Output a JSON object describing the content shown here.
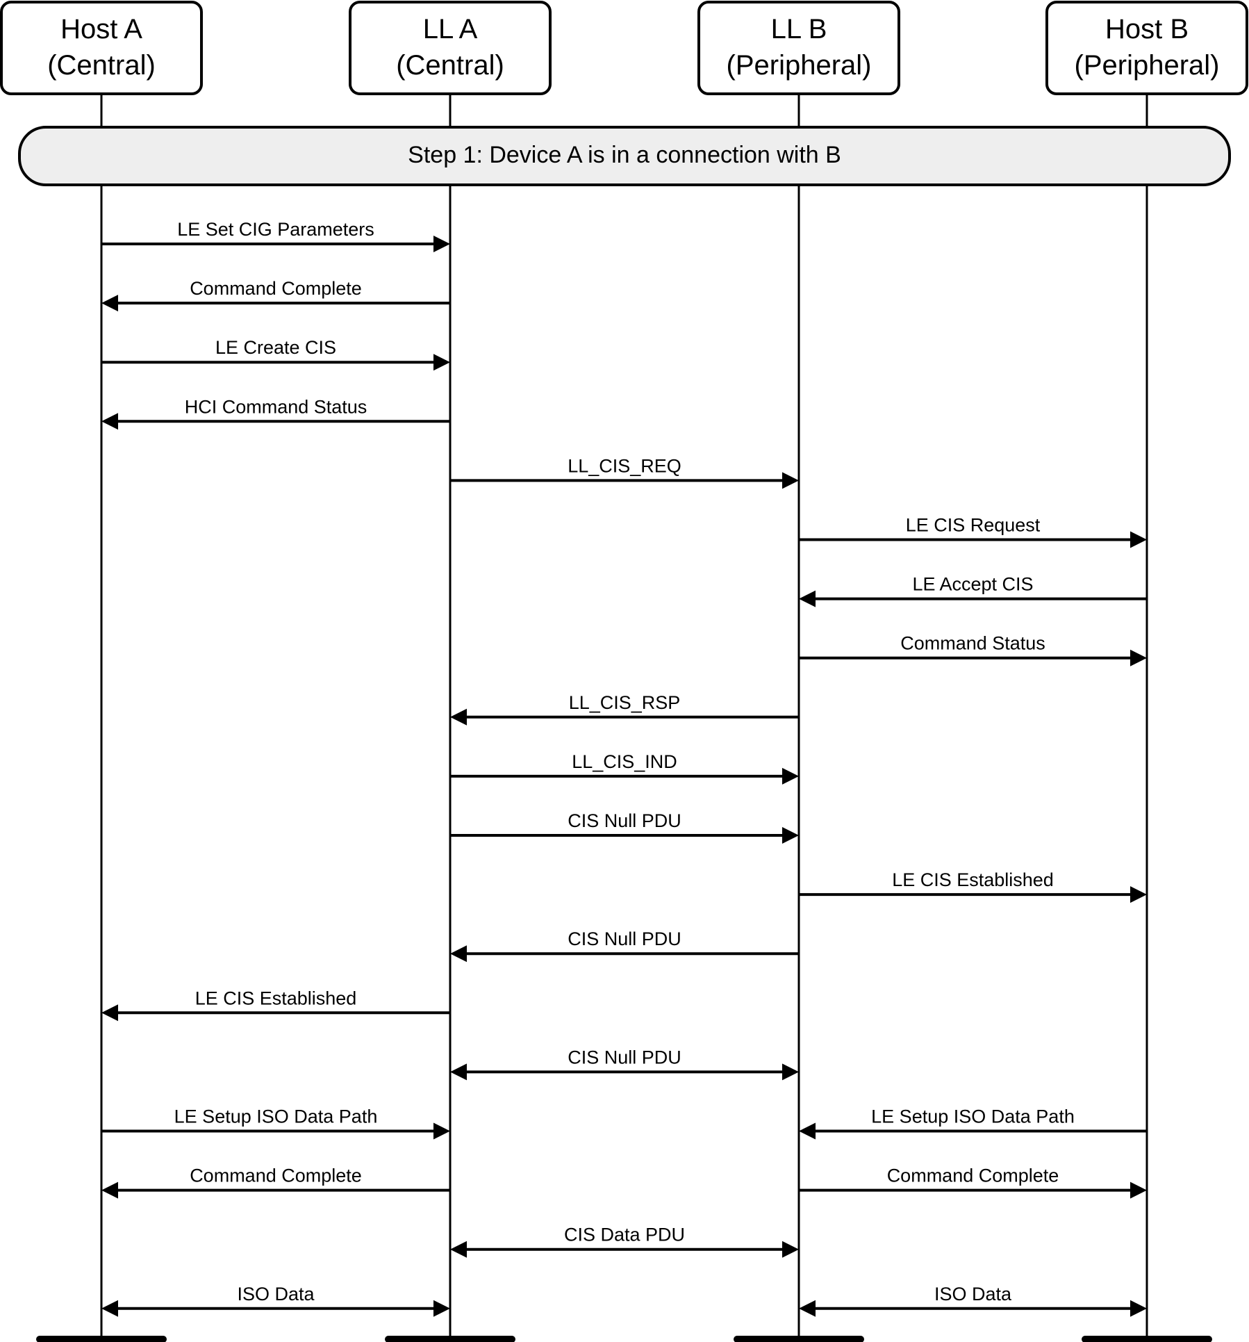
{
  "diagram": {
    "type": "sequence",
    "participants": [
      {
        "id": "hostA",
        "name": "Host A",
        "role": "(Central)"
      },
      {
        "id": "llA",
        "name": "LL A",
        "role": "(Central)"
      },
      {
        "id": "llB",
        "name": "LL B",
        "role": "(Peripheral)"
      },
      {
        "id": "hostB",
        "name": "Host B",
        "role": "(Peripheral)"
      }
    ],
    "step": {
      "label": "Step 1:  Device A is in a connection with B"
    },
    "messages": [
      {
        "label": "LE Set CIG Parameters",
        "from": 0,
        "to": 1,
        "dir": "right"
      },
      {
        "label": "Command Complete",
        "from": 1,
        "to": 0,
        "dir": "left"
      },
      {
        "label": "LE Create CIS",
        "from": 0,
        "to": 1,
        "dir": "right"
      },
      {
        "label": "HCI Command Status",
        "from": 1,
        "to": 0,
        "dir": "left"
      },
      {
        "label": "LL_CIS_REQ",
        "from": 1,
        "to": 2,
        "dir": "right"
      },
      {
        "label": "LE CIS Request",
        "from": 2,
        "to": 3,
        "dir": "right"
      },
      {
        "label": "LE Accept CIS",
        "from": 3,
        "to": 2,
        "dir": "left"
      },
      {
        "label": "Command Status",
        "from": 2,
        "to": 3,
        "dir": "right"
      },
      {
        "label": "LL_CIS_RSP",
        "from": 2,
        "to": 1,
        "dir": "left"
      },
      {
        "label": "LL_CIS_IND",
        "from": 1,
        "to": 2,
        "dir": "right"
      },
      {
        "label": "CIS Null PDU",
        "from": 1,
        "to": 2,
        "dir": "right"
      },
      {
        "label": "LE CIS Established",
        "from": 2,
        "to": 3,
        "dir": "right"
      },
      {
        "label": "CIS Null PDU",
        "from": 2,
        "to": 1,
        "dir": "left"
      },
      {
        "label": "LE CIS Established",
        "from": 1,
        "to": 0,
        "dir": "left"
      },
      {
        "label": "CIS Null PDU",
        "from": 1,
        "to": 2,
        "dir": "both"
      },
      {
        "label": "LE Setup ISO Data Path",
        "from": 0,
        "to": 1,
        "dir": "right",
        "row": 15
      },
      {
        "label": "LE Setup ISO Data Path",
        "from": 3,
        "to": 2,
        "dir": "left",
        "row": 15
      },
      {
        "label": "Command Complete",
        "from": 1,
        "to": 0,
        "dir": "left",
        "row": 16
      },
      {
        "label": "Command Complete",
        "from": 2,
        "to": 3,
        "dir": "right",
        "row": 16
      },
      {
        "label": "CIS Data PDU",
        "from": 1,
        "to": 2,
        "dir": "both",
        "row": 17
      },
      {
        "label": "ISO Data",
        "from": 0,
        "to": 1,
        "dir": "both",
        "row": 18
      },
      {
        "label": "ISO Data",
        "from": 2,
        "to": 3,
        "dir": "both",
        "row": 18
      }
    ]
  },
  "colors": {
    "line": "#000000",
    "step_fill": "#eeeeee",
    "box_fill": "#ffffff"
  }
}
